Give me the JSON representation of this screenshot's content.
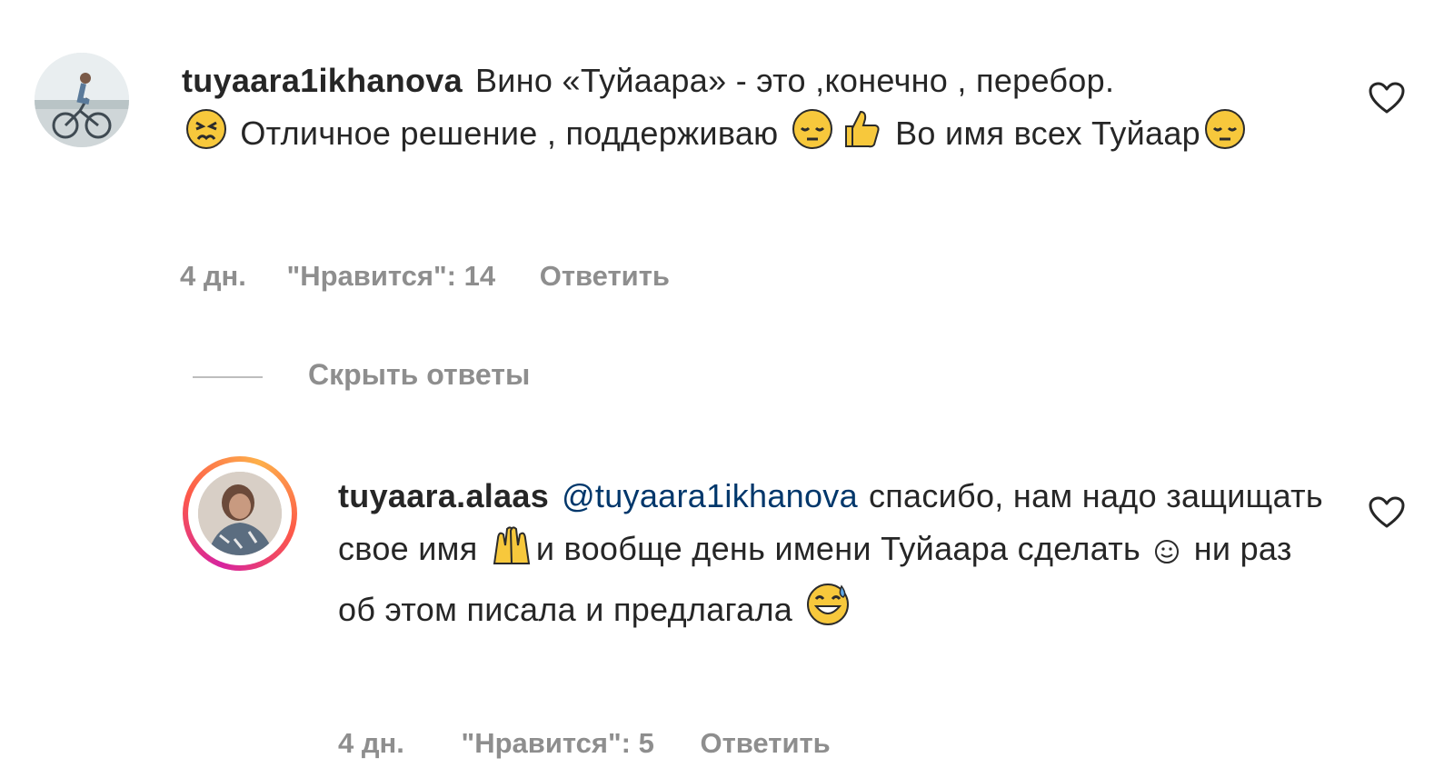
{
  "comment": {
    "username": "tuyaara1ikhanova",
    "text_part1": "Вино «Туйаара» - это ,конечно , перебор.",
    "text_part2": "Отличное решение , поддерживаю",
    "text_part3": "Во имя всех Туйаар",
    "emojis": [
      "persevering-face",
      "pensive-face",
      "thumbs-up",
      "pensive-face"
    ],
    "age": "4 дн.",
    "likes": "\"Нравится\": 14",
    "reply_label": "Ответить"
  },
  "hide_replies_label": "Скрыть ответы",
  "reply": {
    "username": "tuyaara.alaas",
    "mention": "@tuyaara1ikhanova",
    "text_part1": "спасибо, нам надо защищать свое имя",
    "text_part2": "и вообще день имени Туйаара сделать",
    "text_part3": "ни раз об этом писала и предлагала",
    "emojis": [
      "raising-hands",
      "smiling-face",
      "grinning-sweat-face"
    ],
    "age": "4 дн.",
    "likes": "\"Нравится\": 5",
    "reply_label": "Ответить"
  },
  "colors": {
    "text": "#262626",
    "secondary": "#8e8e8e",
    "mention": "#00376b",
    "emoji_yellow": "#f7c83c",
    "story_ring": "#d6249f"
  }
}
